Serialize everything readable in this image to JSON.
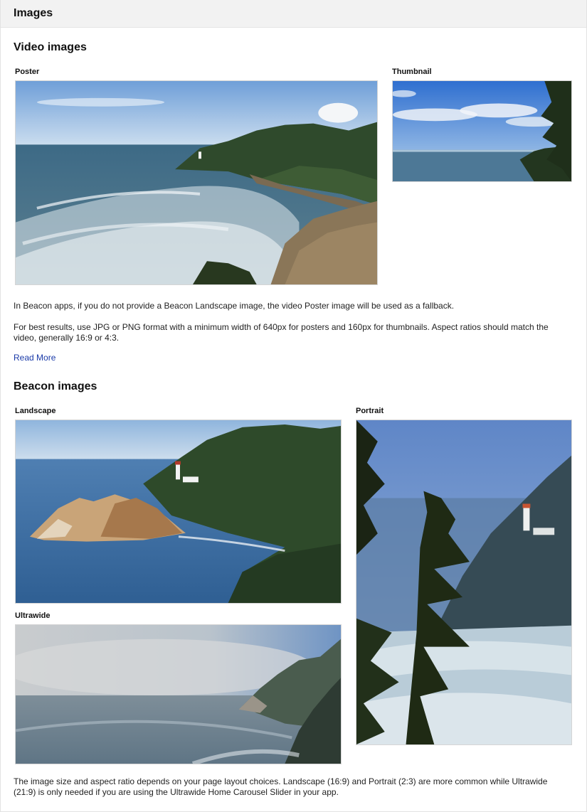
{
  "panel": {
    "title": "Images"
  },
  "video": {
    "heading": "Video images",
    "poster": {
      "label": "Poster",
      "image": "coastal-lighthouse-wide-photo"
    },
    "thumbnail": {
      "label": "Thumbnail",
      "image": "ocean-horizon-tree-photo"
    },
    "note_fallback": "In Beacon apps, if you do not provide a Beacon Landscape image, the video Poster image will be used as a fallback.",
    "note_format": "For best results, use JPG or PNG format with a minimum width of 640px for posters and 160px for thumbnails. Aspect ratios should match the video, generally 16:9 or 4:3.",
    "read_more": "Read More"
  },
  "beacon": {
    "heading": "Beacon images",
    "landscape": {
      "label": "Landscape",
      "image": "lighthouse-headland-rocks-photo"
    },
    "portrait": {
      "label": "Portrait",
      "image": "lighthouse-through-pine-branches-photo"
    },
    "ultrawide": {
      "label": "Ultrawide",
      "image": "foggy-coastline-photo"
    },
    "note_layout": "The image size and aspect ratio depends on your page layout choices. Landscape (16:9) and Portrait (2:3) are more common while Ultrawide (21:9) is only needed if you are using the Ultrawide Home Carousel Slider in your app."
  },
  "colors": {
    "link": "#1a3aa8",
    "header_bg": "#f2f2f2"
  }
}
